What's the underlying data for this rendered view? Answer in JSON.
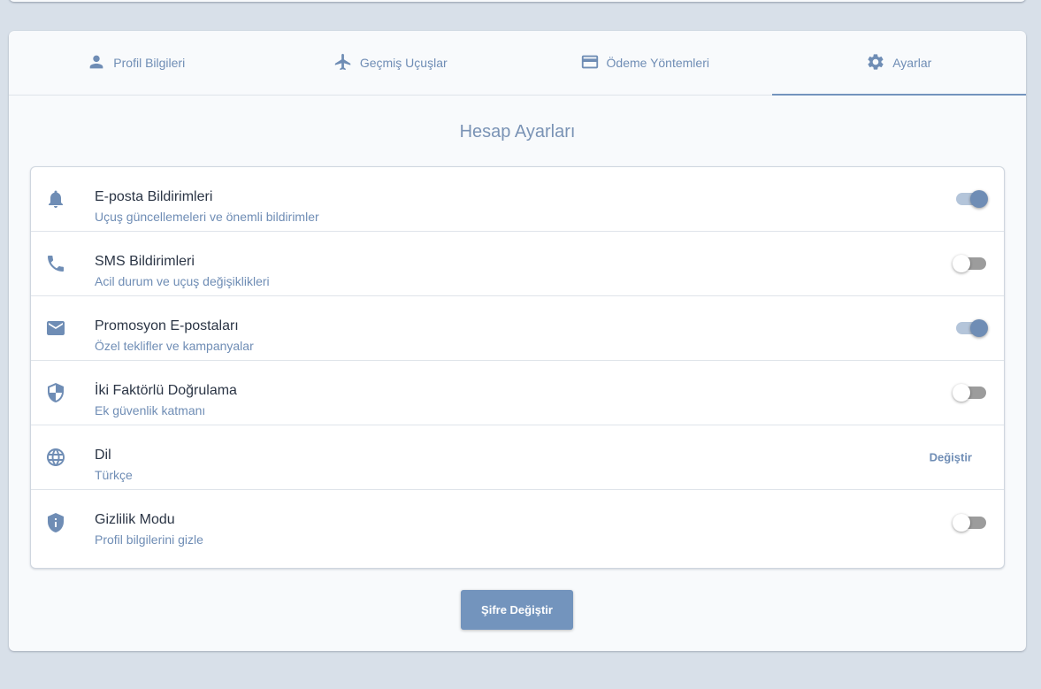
{
  "tabs": [
    {
      "label": "Profil Bilgileri",
      "icon": "person-icon"
    },
    {
      "label": "Geçmiş Uçuşlar",
      "icon": "airplane-icon"
    },
    {
      "label": "Ödeme Yöntemleri",
      "icon": "credit-card-icon"
    },
    {
      "label": "Ayarlar",
      "icon": "gear-icon",
      "active": true
    }
  ],
  "section_title": "Hesap Ayarları",
  "settings": [
    {
      "title": "E-posta Bildirimleri",
      "subtitle": "Uçuş güncellemeleri ve önemli bildirimler",
      "icon": "bell-icon",
      "control": "toggle",
      "on": true
    },
    {
      "title": "SMS Bildirimleri",
      "subtitle": "Acil durum ve uçuş değişiklikleri",
      "icon": "phone-icon",
      "control": "toggle",
      "on": false
    },
    {
      "title": "Promosyon E-postaları",
      "subtitle": "Özel teklifler ve kampanyalar",
      "icon": "envelope-icon",
      "control": "toggle",
      "on": true
    },
    {
      "title": "İki Faktörlü Doğrulama",
      "subtitle": "Ek güvenlik katmanı",
      "icon": "shield-icon",
      "control": "toggle",
      "on": false
    },
    {
      "title": "Dil",
      "subtitle": "Türkçe",
      "icon": "globe-icon",
      "control": "link",
      "action_label": "Değiştir"
    },
    {
      "title": "Gizlilik Modu",
      "subtitle": "Profil bilgilerini gizle",
      "icon": "info-shield-icon",
      "control": "toggle",
      "on": false
    }
  ],
  "change_password_label": "Şifre Değiştir",
  "colors": {
    "accent": "#7394bd",
    "background": "#d8e0e9",
    "card": "#f8fafc"
  }
}
